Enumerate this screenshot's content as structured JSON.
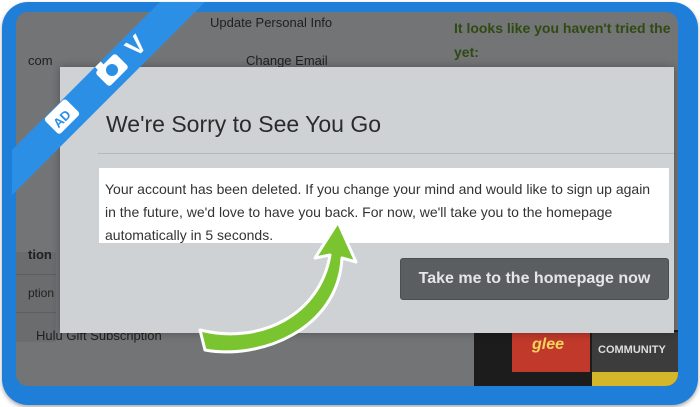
{
  "background_page": {
    "update_personal_info": "Update Personal Info",
    "change_email": "Change Email",
    "left_fragment_com": "com",
    "left_fragment_tion": "tion",
    "left_fragment_ption": "ption",
    "gift_subscription": "Hulu Gift Subscription",
    "promo_text_line1": "It looks like you haven't tried the",
    "promo_text_line2": "yet:",
    "thumb_glee": "glee",
    "thumb_community": "COMMUNITY"
  },
  "modal": {
    "title": "We're Sorry to See You Go",
    "message": "Your account has been deleted. If you change your mind and would like to sign up again in the future, we'd love to have you back. For now, we'll take you to the homepage automatically in 5 seconds.",
    "button_label": "Take me to the homepage now"
  },
  "colors": {
    "frame_blue": "#1f7fd8",
    "arrow_green": "#7ac52f",
    "button_bg": "#5b5e61"
  },
  "icons": [
    "ad-tag-icon",
    "camera-icon",
    "v-letter-icon",
    "curved-arrow-icon"
  ]
}
